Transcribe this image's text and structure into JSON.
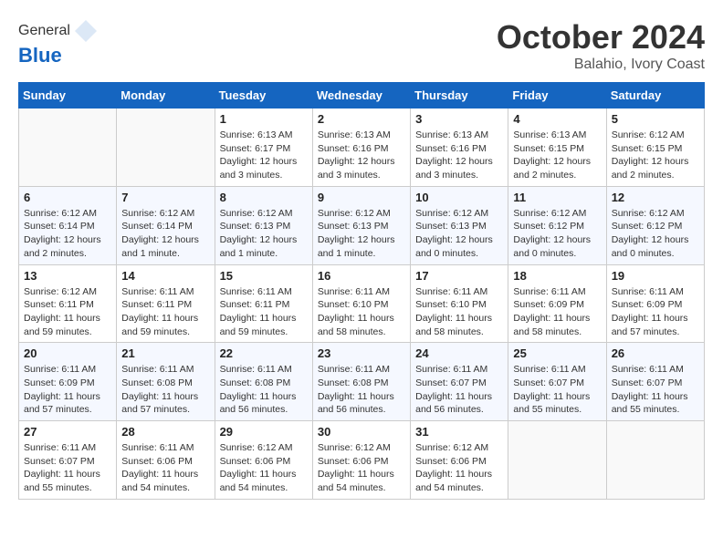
{
  "header": {
    "logo_general": "General",
    "logo_blue": "Blue",
    "month_year": "October 2024",
    "location": "Balahio, Ivory Coast"
  },
  "days_of_week": [
    "Sunday",
    "Monday",
    "Tuesday",
    "Wednesday",
    "Thursday",
    "Friday",
    "Saturday"
  ],
  "weeks": [
    [
      {
        "day": "",
        "info": ""
      },
      {
        "day": "",
        "info": ""
      },
      {
        "day": "1",
        "info": "Sunrise: 6:13 AM\nSunset: 6:17 PM\nDaylight: 12 hours and 3 minutes."
      },
      {
        "day": "2",
        "info": "Sunrise: 6:13 AM\nSunset: 6:16 PM\nDaylight: 12 hours and 3 minutes."
      },
      {
        "day": "3",
        "info": "Sunrise: 6:13 AM\nSunset: 6:16 PM\nDaylight: 12 hours and 3 minutes."
      },
      {
        "day": "4",
        "info": "Sunrise: 6:13 AM\nSunset: 6:15 PM\nDaylight: 12 hours and 2 minutes."
      },
      {
        "day": "5",
        "info": "Sunrise: 6:12 AM\nSunset: 6:15 PM\nDaylight: 12 hours and 2 minutes."
      }
    ],
    [
      {
        "day": "6",
        "info": "Sunrise: 6:12 AM\nSunset: 6:14 PM\nDaylight: 12 hours and 2 minutes."
      },
      {
        "day": "7",
        "info": "Sunrise: 6:12 AM\nSunset: 6:14 PM\nDaylight: 12 hours and 1 minute."
      },
      {
        "day": "8",
        "info": "Sunrise: 6:12 AM\nSunset: 6:13 PM\nDaylight: 12 hours and 1 minute."
      },
      {
        "day": "9",
        "info": "Sunrise: 6:12 AM\nSunset: 6:13 PM\nDaylight: 12 hours and 1 minute."
      },
      {
        "day": "10",
        "info": "Sunrise: 6:12 AM\nSunset: 6:13 PM\nDaylight: 12 hours and 0 minutes."
      },
      {
        "day": "11",
        "info": "Sunrise: 6:12 AM\nSunset: 6:12 PM\nDaylight: 12 hours and 0 minutes."
      },
      {
        "day": "12",
        "info": "Sunrise: 6:12 AM\nSunset: 6:12 PM\nDaylight: 12 hours and 0 minutes."
      }
    ],
    [
      {
        "day": "13",
        "info": "Sunrise: 6:12 AM\nSunset: 6:11 PM\nDaylight: 11 hours and 59 minutes."
      },
      {
        "day": "14",
        "info": "Sunrise: 6:11 AM\nSunset: 6:11 PM\nDaylight: 11 hours and 59 minutes."
      },
      {
        "day": "15",
        "info": "Sunrise: 6:11 AM\nSunset: 6:11 PM\nDaylight: 11 hours and 59 minutes."
      },
      {
        "day": "16",
        "info": "Sunrise: 6:11 AM\nSunset: 6:10 PM\nDaylight: 11 hours and 58 minutes."
      },
      {
        "day": "17",
        "info": "Sunrise: 6:11 AM\nSunset: 6:10 PM\nDaylight: 11 hours and 58 minutes."
      },
      {
        "day": "18",
        "info": "Sunrise: 6:11 AM\nSunset: 6:09 PM\nDaylight: 11 hours and 58 minutes."
      },
      {
        "day": "19",
        "info": "Sunrise: 6:11 AM\nSunset: 6:09 PM\nDaylight: 11 hours and 57 minutes."
      }
    ],
    [
      {
        "day": "20",
        "info": "Sunrise: 6:11 AM\nSunset: 6:09 PM\nDaylight: 11 hours and 57 minutes."
      },
      {
        "day": "21",
        "info": "Sunrise: 6:11 AM\nSunset: 6:08 PM\nDaylight: 11 hours and 57 minutes."
      },
      {
        "day": "22",
        "info": "Sunrise: 6:11 AM\nSunset: 6:08 PM\nDaylight: 11 hours and 56 minutes."
      },
      {
        "day": "23",
        "info": "Sunrise: 6:11 AM\nSunset: 6:08 PM\nDaylight: 11 hours and 56 minutes."
      },
      {
        "day": "24",
        "info": "Sunrise: 6:11 AM\nSunset: 6:07 PM\nDaylight: 11 hours and 56 minutes."
      },
      {
        "day": "25",
        "info": "Sunrise: 6:11 AM\nSunset: 6:07 PM\nDaylight: 11 hours and 55 minutes."
      },
      {
        "day": "26",
        "info": "Sunrise: 6:11 AM\nSunset: 6:07 PM\nDaylight: 11 hours and 55 minutes."
      }
    ],
    [
      {
        "day": "27",
        "info": "Sunrise: 6:11 AM\nSunset: 6:07 PM\nDaylight: 11 hours and 55 minutes."
      },
      {
        "day": "28",
        "info": "Sunrise: 6:11 AM\nSunset: 6:06 PM\nDaylight: 11 hours and 54 minutes."
      },
      {
        "day": "29",
        "info": "Sunrise: 6:12 AM\nSunset: 6:06 PM\nDaylight: 11 hours and 54 minutes."
      },
      {
        "day": "30",
        "info": "Sunrise: 6:12 AM\nSunset: 6:06 PM\nDaylight: 11 hours and 54 minutes."
      },
      {
        "day": "31",
        "info": "Sunrise: 6:12 AM\nSunset: 6:06 PM\nDaylight: 11 hours and 54 minutes."
      },
      {
        "day": "",
        "info": ""
      },
      {
        "day": "",
        "info": ""
      }
    ]
  ]
}
